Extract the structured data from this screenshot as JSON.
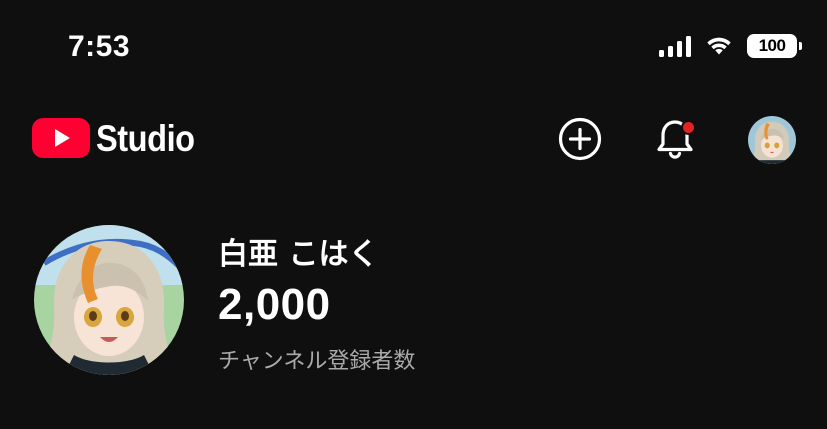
{
  "status_bar": {
    "time": "7:53",
    "battery": "100",
    "icons": [
      "cellular-signal-icon",
      "wifi-icon",
      "battery-icon"
    ]
  },
  "header": {
    "app_name": "Studio",
    "logo_icon": "youtube-play-icon",
    "brand_color": "#ff0033",
    "actions": [
      "create-icon",
      "notifications-bell-icon",
      "account-avatar"
    ],
    "notification_dot_color": "#e02424"
  },
  "channel": {
    "name": "白亜 こはく",
    "subscriber_count": "2,000",
    "subscriber_label": "チャンネル登録者数"
  }
}
